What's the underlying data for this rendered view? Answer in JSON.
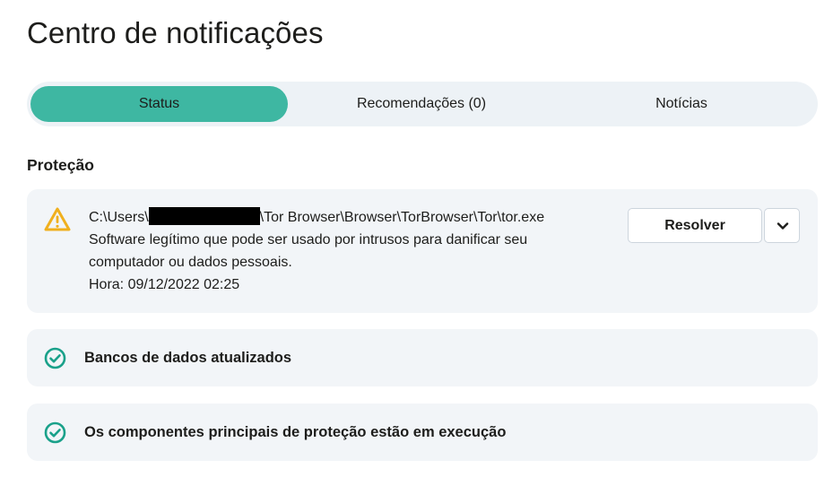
{
  "page": {
    "title": "Centro de notificações"
  },
  "tabs": [
    {
      "label": "Status",
      "active": true
    },
    {
      "label": "Recomendações (0)",
      "active": false
    },
    {
      "label": "Notícias",
      "active": false
    }
  ],
  "section": {
    "title": "Proteção"
  },
  "alert": {
    "icon": "warning-triangle-icon",
    "path_prefix": "C:\\Users\\",
    "path_suffix": "\\Tor Browser\\Browser\\TorBrowser\\Tor\\tor.exe",
    "description": "Software legítimo que pode ser usado por intrusos para danificar seu computador ou dados pessoais.",
    "time": "Hora: 09/12/2022 02:25",
    "resolve_label": "Resolver"
  },
  "statuses": [
    {
      "icon": "check-circle-icon",
      "label": "Bancos de dados atualizados"
    },
    {
      "icon": "check-circle-icon",
      "label": "Os componentes principais de proteção estão em execução"
    }
  ],
  "colors": {
    "accent": "#3eb7a2",
    "warning": "#f0b01e",
    "ok": "#1aa18a",
    "card_bg": "#f2f5f8",
    "tabs_bg": "#edf2f6"
  }
}
